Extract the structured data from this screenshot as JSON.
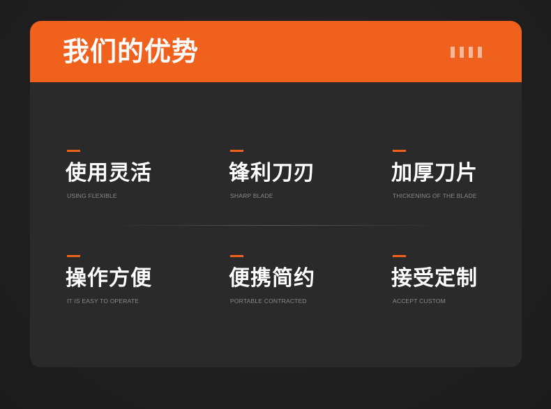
{
  "header": {
    "title": "我们的优势"
  },
  "colors": {
    "accent": "#f0611e",
    "card_bg": "#2a2a2a",
    "page_bg": "#1d1d1d",
    "title_text": "#ffffff",
    "subtitle_text": "#8a8a8a"
  },
  "features": [
    {
      "title": "使用灵活",
      "subtitle": "USING FLEXIBLE"
    },
    {
      "title": "锋利刀刃",
      "subtitle": "SHARP BLADE"
    },
    {
      "title": "加厚刀片",
      "subtitle": "THICKENING OF THE BLADE"
    },
    {
      "title": "操作方便",
      "subtitle": "IT IS EASY TO OPERATE"
    },
    {
      "title": "便携简约",
      "subtitle": "PORTABLE CONTRACTED"
    },
    {
      "title": "接受定制",
      "subtitle": "ACCEPT CUSTOM"
    }
  ]
}
